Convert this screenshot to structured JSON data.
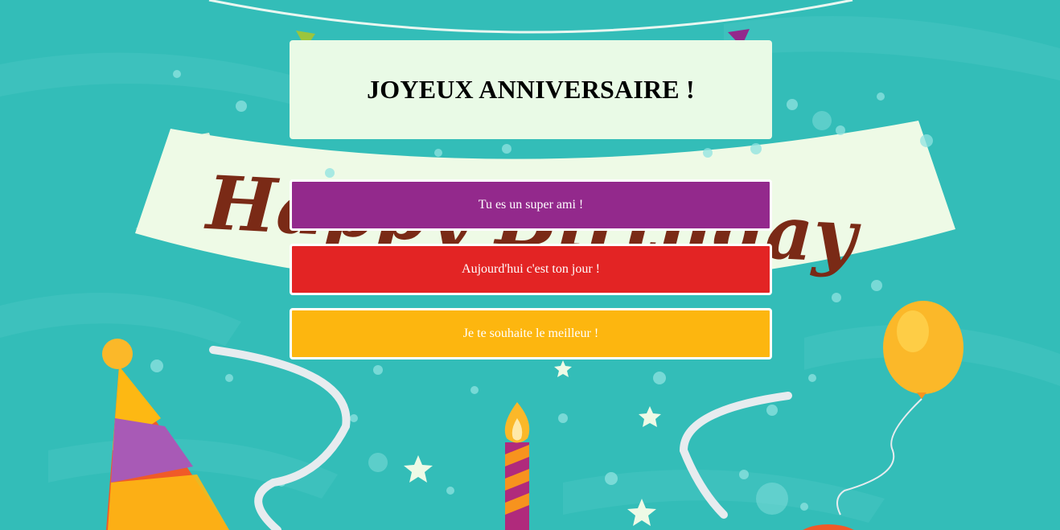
{
  "page": {
    "title": "JOYEUX ANNIVERSAIRE !"
  },
  "messages": [
    {
      "label": "Tu es un super ami !",
      "color": "#93298c"
    },
    {
      "label": "Aujourd'hui c'est ton jour !",
      "color": "#e32424"
    },
    {
      "label": "Je te souhaite le meilleur !",
      "color": "#fdb60f"
    }
  ],
  "background": {
    "banner_text": "Happy Birthday",
    "colors": {
      "teal": "#33bdb8",
      "banner": "#eefae6",
      "banner_text": "#7a2a16",
      "hat_red": "#f05a28",
      "hat_yellow": "#fdb813",
      "hat_purple": "#a85ab6",
      "balloon": "#fbb829",
      "ribbon": "#e7ecef"
    }
  },
  "icons": [
    "party-hat-icon",
    "balloon-icon",
    "candle-icon",
    "star-icon"
  ]
}
